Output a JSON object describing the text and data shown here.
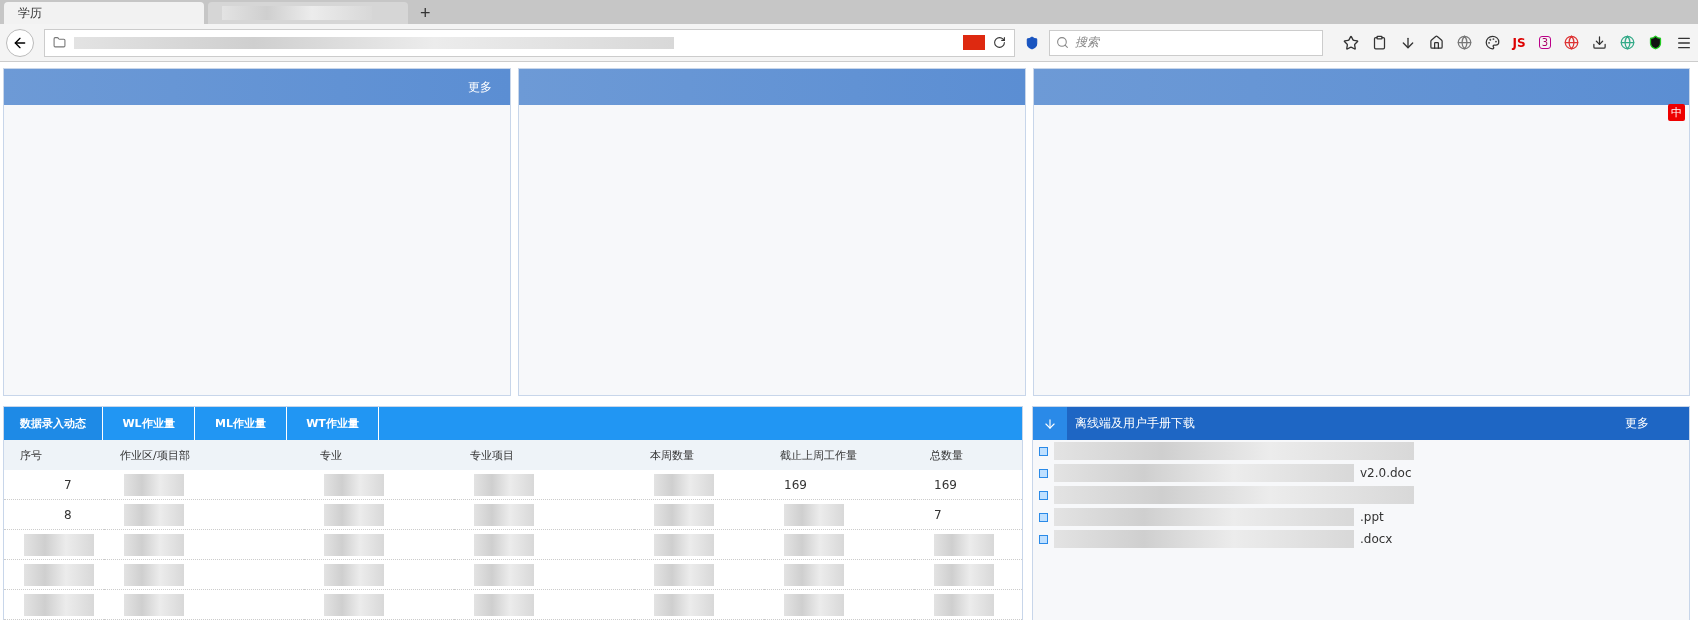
{
  "browser": {
    "tabs": [
      {
        "kind": "text",
        "label": "学历",
        "selected": true
      },
      {
        "kind": "blurred",
        "selected": false
      }
    ],
    "new_tab": "+",
    "search": {
      "placeholder": "搜索"
    },
    "addon_badge": "3",
    "js_label": "JS"
  },
  "top_panels": [
    {
      "kind": "more",
      "label": "更多"
    },
    {
      "kind": "plain"
    },
    {
      "kind": "badge",
      "label": "中"
    }
  ],
  "workload": {
    "tabs": [
      {
        "label": "数据录入动态",
        "selected": true
      },
      {
        "label": "WL作业量",
        "selected": false
      },
      {
        "label": "ML作业量",
        "selected": false
      },
      {
        "label": "WT作业量",
        "selected": false
      }
    ],
    "columns": [
      "序号",
      "作业区/项目部",
      "专业",
      "专业项目",
      "本周数量",
      "截止上周工作量",
      "总数量"
    ],
    "rows": [
      {
        "kind": "data",
        "no": "7",
        "last_week": "169",
        "total": "169"
      },
      {
        "kind": "data",
        "no": "8",
        "total": "7"
      },
      {
        "kind": "blurred"
      },
      {
        "kind": "blurred"
      },
      {
        "kind": "blurred"
      }
    ]
  },
  "downloads": {
    "title": "离线端及用户手册下载",
    "more": "更多",
    "files": [
      {
        "kind": "blurred"
      },
      {
        "kind": "file",
        "name": "v2.0.doc"
      },
      {
        "kind": "blurred"
      },
      {
        "kind": "file",
        "name": ".ppt"
      },
      {
        "kind": "file",
        "name": ".docx"
      }
    ]
  }
}
